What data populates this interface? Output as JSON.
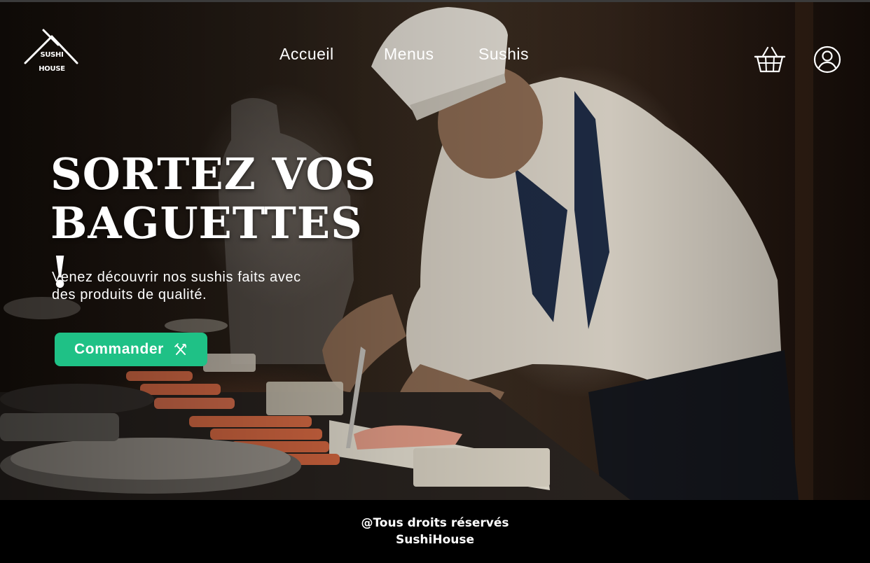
{
  "brand": {
    "logo_line1": "SUSHI",
    "logo_line2": "HOUSE"
  },
  "nav": {
    "items": [
      "Accueil",
      "Menus",
      "Sushis"
    ]
  },
  "header_icons": {
    "cart": "basket-icon",
    "account": "user-icon"
  },
  "hero": {
    "title_line1": "SORTEZ VOS",
    "title_line2": "BAGUETTES !",
    "subtitle_line1": "Venez découvrir nos sushis faits avec",
    "subtitle_line2": "des produits de qualité.",
    "cta_label": "Commander",
    "cta_icon": "utensils-icon"
  },
  "footer": {
    "line1": "@Tous droits réservés",
    "line2": "SushiHouse"
  },
  "colors": {
    "accent": "#1fc186",
    "footer_bg": "#000000",
    "text": "#ffffff"
  }
}
